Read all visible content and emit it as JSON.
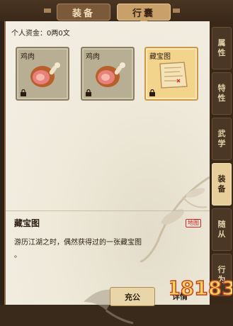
{
  "tabs": {
    "equip_label": "装备",
    "bag_label": "行囊"
  },
  "funds": {
    "text": "个人资金：0两0文"
  },
  "inventory": [
    {
      "label": "鸡肉",
      "icon": "chicken-leg-icon",
      "locked": true
    },
    {
      "label": "鸡肉",
      "icon": "chicken-leg-icon",
      "locked": true
    },
    {
      "label": "藏宝图",
      "icon": "treasure-map-icon",
      "locked": true,
      "selected": true
    }
  ],
  "detail": {
    "name": "藏宝图",
    "tag": "地图",
    "description": "游历江湖之时，偶然获得过的一张藏宝图",
    "description_end": "。"
  },
  "actions": {
    "donate_label": "充公",
    "detail_label": "详情"
  },
  "side_tabs": [
    {
      "chars": [
        "属",
        "性"
      ]
    },
    {
      "chars": [
        "特",
        "性"
      ]
    },
    {
      "chars": [
        "武",
        "学"
      ]
    },
    {
      "chars": [
        "装",
        "备"
      ]
    },
    {
      "chars": [
        "随",
        "从"
      ]
    },
    {
      "chars": [
        "行",
        "为"
      ]
    }
  ],
  "watermark": {
    "text": "18183"
  },
  "colors": {
    "selected_slot": "#f3d48d",
    "tag_red": "#c62b2b",
    "active_tab": "#c9a06a"
  }
}
